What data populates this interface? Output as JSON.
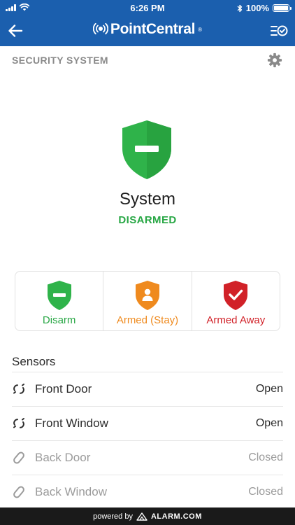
{
  "status_bar": {
    "time": "6:26 PM",
    "battery": "100%"
  },
  "nav": {
    "brand": "PointCentral",
    "trademark": "®"
  },
  "section": {
    "title": "SECURITY SYSTEM"
  },
  "system": {
    "name": "System",
    "state": "DISARMED"
  },
  "arm_buttons": [
    {
      "label": "Disarm",
      "color": "#2fb34a"
    },
    {
      "label": "Armed (Stay)",
      "color": "#ef8a1e"
    },
    {
      "label": "Armed Away",
      "color": "#d12128"
    }
  ],
  "sensors": {
    "title": "Sensors",
    "items": [
      {
        "name": "Front Door",
        "state": "Open"
      },
      {
        "name": "Front Window",
        "state": "Open"
      },
      {
        "name": "Back Door",
        "state": "Closed"
      },
      {
        "name": "Back Window",
        "state": "Closed"
      }
    ]
  },
  "footer": {
    "powered_by": "powered by",
    "partner": "ALARM.COM"
  },
  "colors": {
    "header_blue": "#1b5fae",
    "disarmed_green": "#28a745"
  }
}
